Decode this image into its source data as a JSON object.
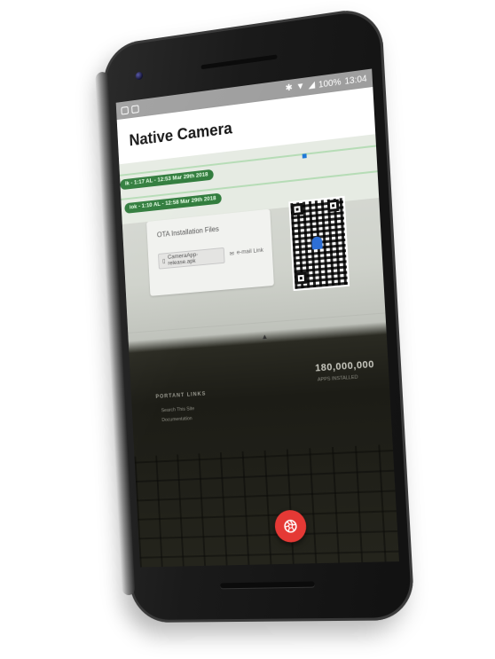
{
  "status_bar": {
    "battery": "100%",
    "time": "13:04",
    "left_icons": [
      "image-icon",
      "photo-icon"
    ],
    "right_icons": [
      "bluetooth-icon",
      "wifi-icon",
      "signal-icon",
      "battery-icon"
    ]
  },
  "app_bar": {
    "title": "Native Camera"
  },
  "preview": {
    "green_row_1": "ik - 1:17 AL - 12:53 Mar 29th 2018",
    "green_row_2": "iok - 1:10 AL - 12:58 Mar 29th 2018",
    "card_title": "OTA Installation Files",
    "apk_button": "CameraApp-release.apk",
    "mail_link": "e-mail Link",
    "stat_value": "180,000,000",
    "stat_label": "APPS INSTALLED",
    "links_heading": "PORTANT LINKS",
    "link_1": "Search This Site",
    "link_2": "Documentation"
  },
  "controls": {
    "shutter_icon": "camera-shutter-icon",
    "shutter_color": "#e53935"
  }
}
